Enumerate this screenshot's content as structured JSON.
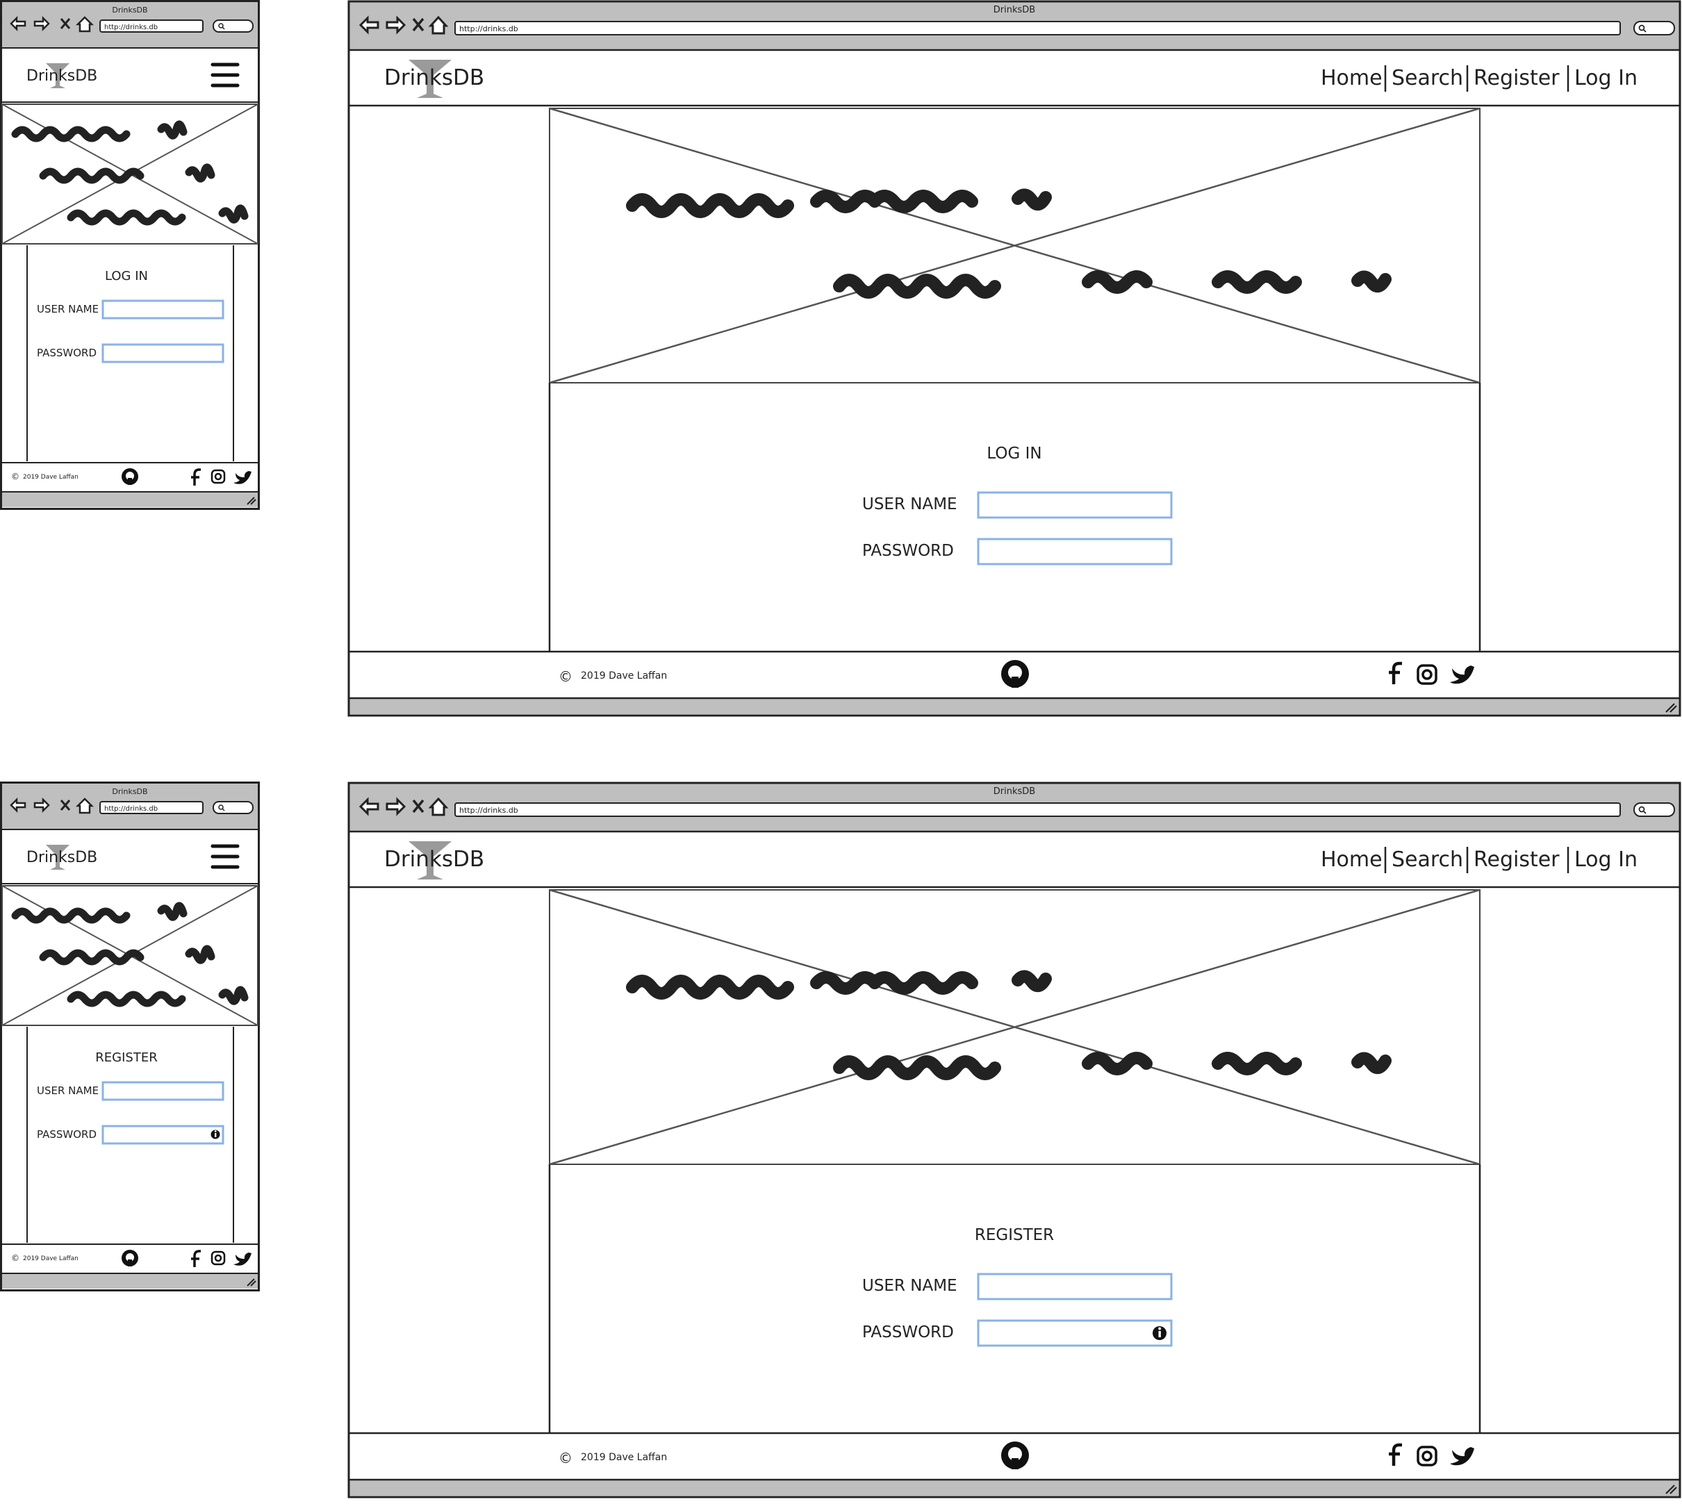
{
  "browser": {
    "title": "DrinksDB",
    "url": "http://drinks.db"
  },
  "site": {
    "logo_text": "DrinksDB",
    "nav": [
      "Home",
      "Search",
      "Register",
      "Log In"
    ]
  },
  "pages": {
    "login": {
      "heading": "LOG IN",
      "username_label": "USER NAME",
      "password_label": "PASSWORD"
    },
    "register": {
      "heading": "REGISTER",
      "username_label": "USER NAME",
      "password_label": "PASSWORD"
    }
  },
  "footer": {
    "copyright_symbol": "©",
    "copyright_text": "2019 Dave Laffan"
  },
  "icons": {
    "back": "arrow-left-icon",
    "forward": "arrow-right-icon",
    "stop": "close-icon",
    "home": "home-icon",
    "search": "search-icon",
    "menu": "hamburger-menu-icon",
    "github": "github-icon",
    "facebook": "facebook-icon",
    "instagram": "instagram-icon",
    "twitter": "twitter-icon",
    "info": "info-icon",
    "logo": "cocktail-glass-icon",
    "resize": "resize-grip-icon"
  },
  "colors": {
    "chrome_gray": "#bfbfbf",
    "input_border": "#8ab2e6",
    "ink": "#222222"
  }
}
